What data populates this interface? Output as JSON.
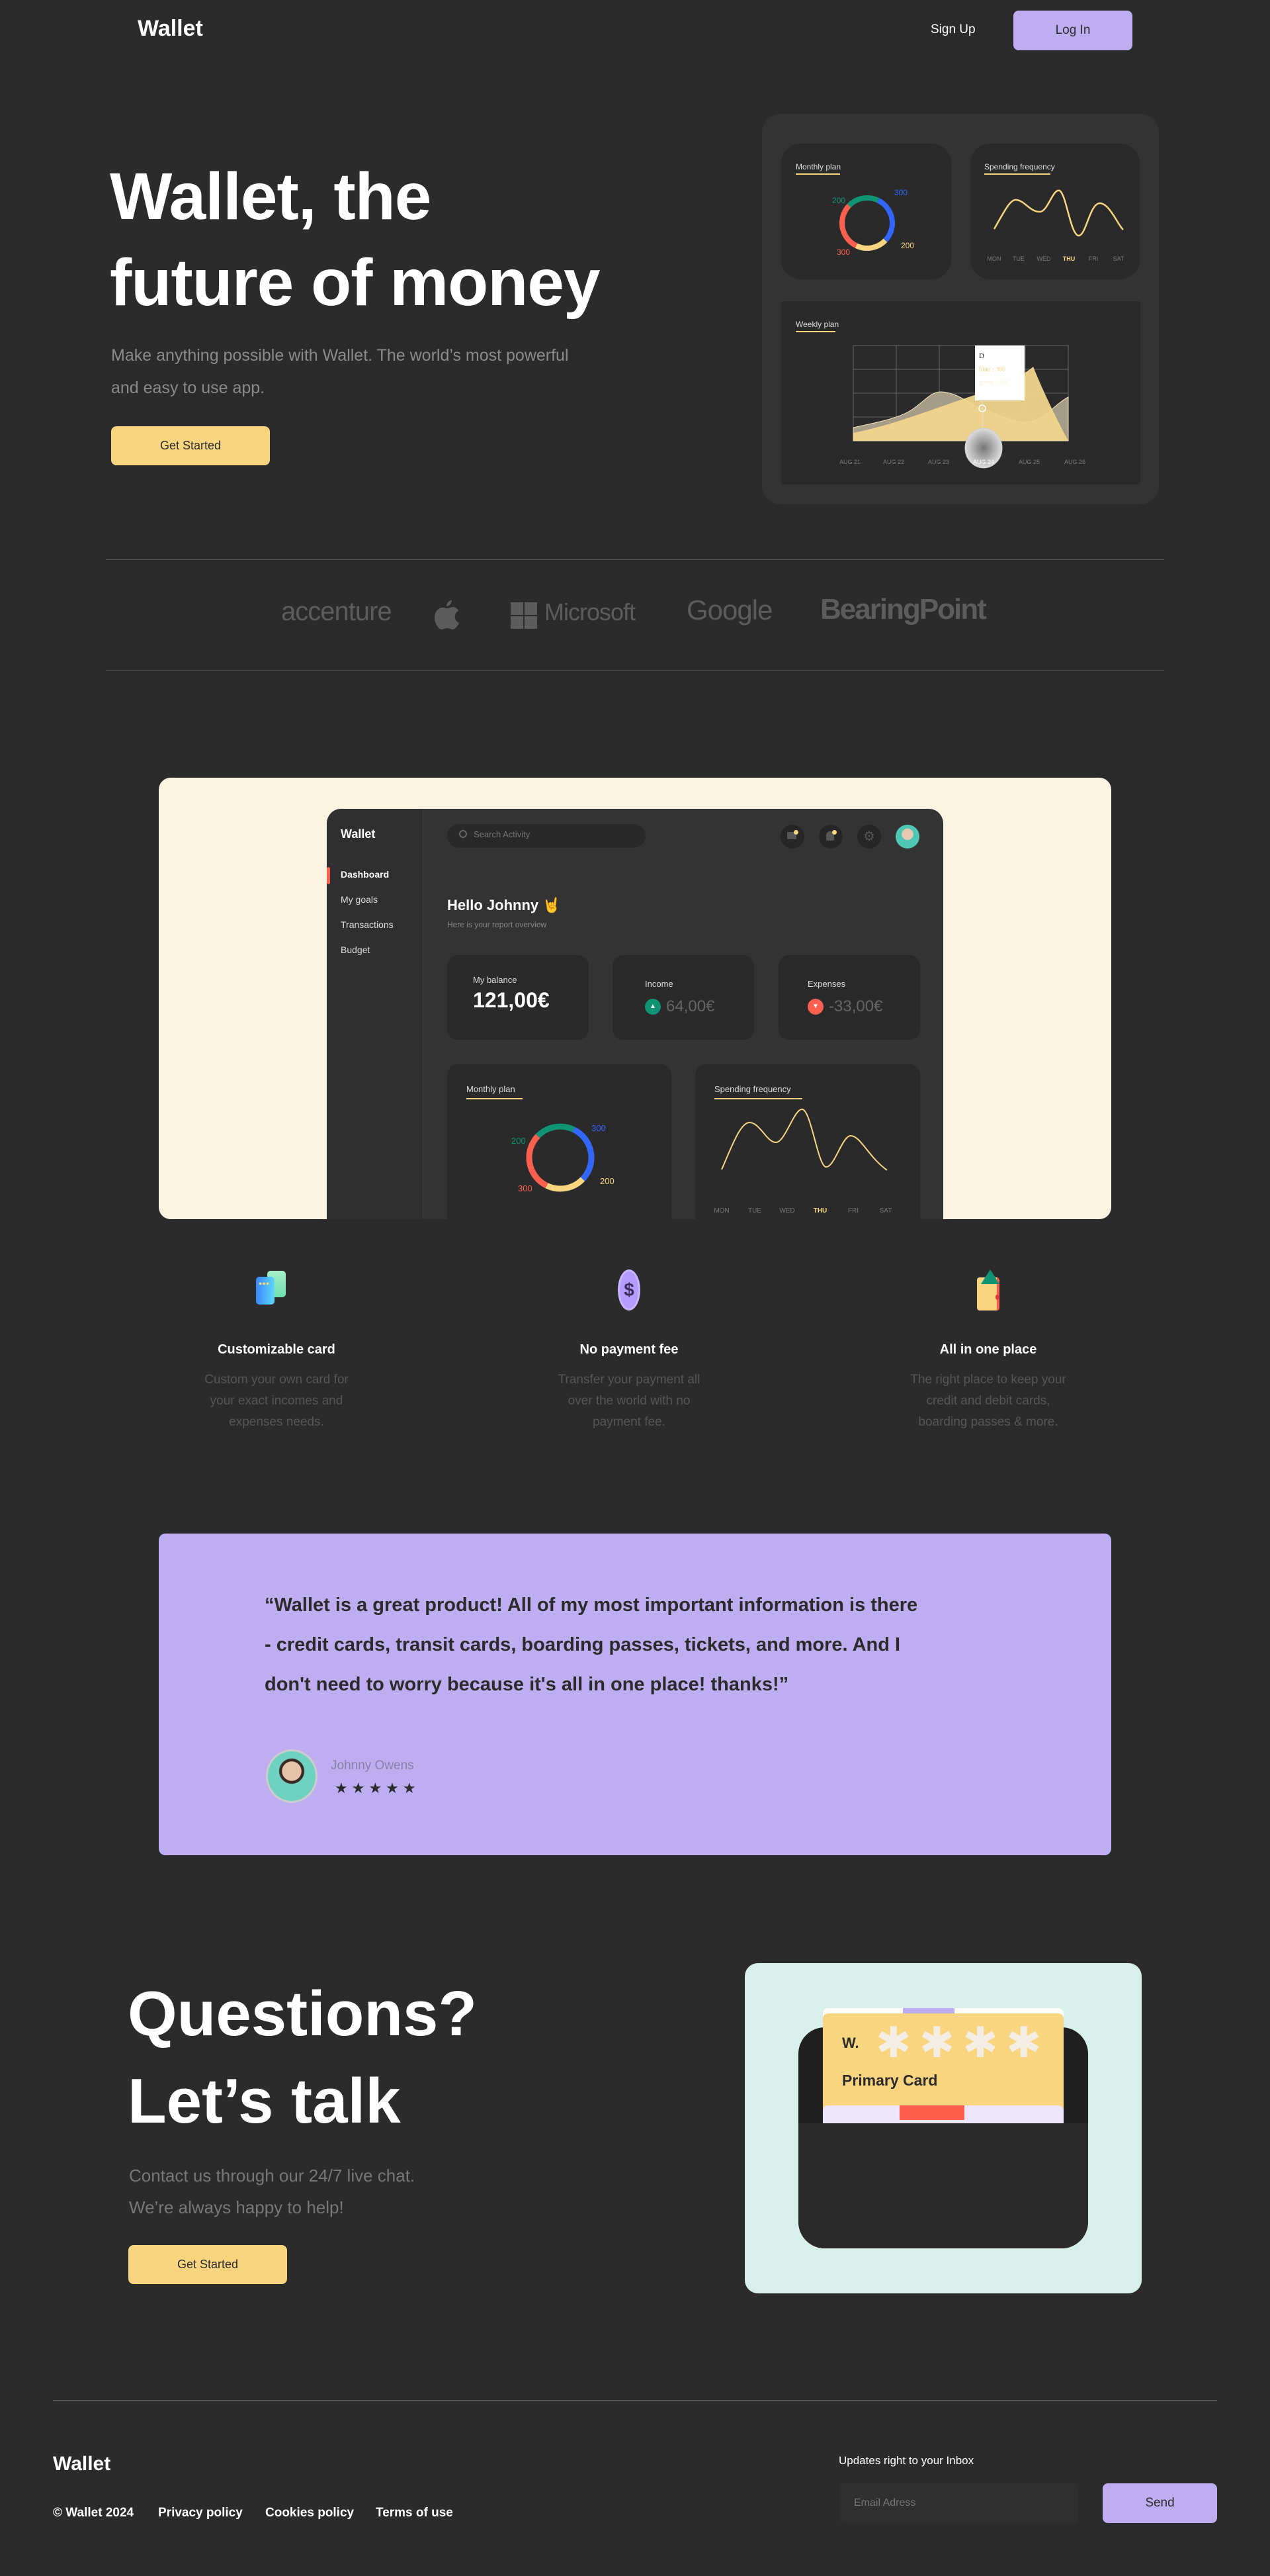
{
  "nav": {
    "logo": "Wallet",
    "signup": "Sign Up",
    "login": "Log In"
  },
  "hero": {
    "title_line1": "Wallet, the",
    "title_line2": "future of money",
    "subtitle_line1": "Make anything possible with Wallet. The world’s most powerful",
    "subtitle_line2": "and easy to use app.",
    "cta": "Get Started",
    "panel": {
      "monthly_title": "Monthly plan",
      "spending_title": "Spending frequency",
      "weekly_title": "Weekly plan",
      "donut": [
        {
          "label": "300",
          "value": 300,
          "color": "#3366ff"
        },
        {
          "label": "200",
          "value": 200,
          "color": "#f9d580"
        },
        {
          "label": "300",
          "value": 300,
          "color": "#ff5f4f"
        },
        {
          "label": "200",
          "value": 200,
          "color": "#0f9473"
        }
      ],
      "days": [
        "MON",
        "TUE",
        "WED",
        "THU",
        "FRI",
        "SAT"
      ],
      "active_day": "THU",
      "weekly_dates": [
        "AUG 21",
        "AUG 22",
        "AUG 23",
        "AUG 24",
        "AUG 25",
        "AUG 26"
      ],
      "active_date": "AUG 24",
      "tooltip": {
        "title": "D",
        "line1": "blue : 300",
        "line2": "green : 200"
      }
    }
  },
  "partners": [
    "accenture",
    "apple",
    "Microsoft",
    "Google",
    "BearingPoint"
  ],
  "dashboard": {
    "logo": "Wallet",
    "menu": [
      "Dashboard",
      "My goals",
      "Transactions",
      "Budget"
    ],
    "active_menu": "Dashboard",
    "search_placeholder": "Search Activity",
    "greeting": "Hello Johnny 🤘",
    "greeting_sub": "Here is your report overview",
    "balance_label": "My balance",
    "balance_value": "121,00€",
    "income_label": "Income",
    "income_value": "64,00€",
    "expenses_label": "Expenses",
    "expenses_value": "-33,00€",
    "monthly_title": "Monthly plan",
    "spending_title": "Spending frequency"
  },
  "features": [
    {
      "icon": "cards-icon",
      "title": "Customizable card",
      "lines": [
        "Custom your own card for",
        "your exact incomes and",
        "expenses needs."
      ]
    },
    {
      "icon": "dollar-coin-icon",
      "title": "No payment fee",
      "lines": [
        "Transfer your payment all",
        "over the world with no",
        "payment fee."
      ]
    },
    {
      "icon": "wallet-icon",
      "title": "All in one place",
      "lines": [
        "The right place to keep your",
        "credit and debit cards,",
        "boarding passes & more."
      ]
    }
  ],
  "testimonial": {
    "line1": "“Wallet is a great product! All of my most important information is there",
    "line2": "- credit cards, transit cards, boarding passes, tickets, and more. And I",
    "line3": "don't need to worry because it's all in one place! thanks!”",
    "author": "Johnny Owens",
    "rating": 5
  },
  "contact": {
    "title_line1": "Questions?",
    "title_line2": "Let’s talk",
    "text_line1": "Contact us through our 24/7 live chat.",
    "text_line2": "We’re always happy to help!",
    "cta": "Get Started",
    "card_brand": "W.",
    "card_name": "Primary Card"
  },
  "footer": {
    "logo": "Wallet",
    "copyright": "© Wallet 2024",
    "links": [
      "Privacy policy",
      "Cookies policy",
      "Terms of use"
    ],
    "newsletter_label": "Updates right to your Inbox",
    "email_placeholder": "Email Adress",
    "send": "Send"
  },
  "colors": {
    "bg": "#2b2b2b",
    "yellow": "#f9d580",
    "purple": "#bfadf2",
    "cream": "#fdf5e2",
    "mint": "#d8f0ea",
    "blue": "#3366ff",
    "green": "#0f9473",
    "red": "#ff5f4f"
  }
}
